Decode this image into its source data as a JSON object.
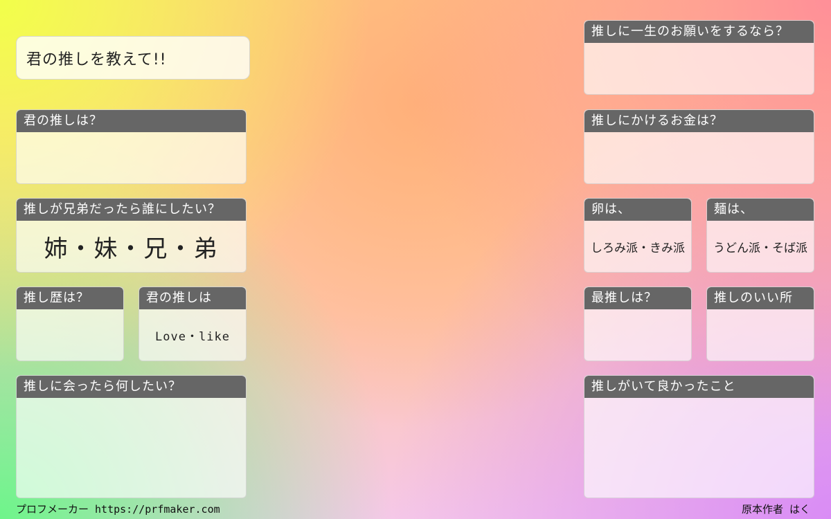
{
  "title": "君の推しを教えて!!",
  "left": {
    "q_oshi": "君の推しは？",
    "q_sibling": "推しが兄弟だったら誰にしたい？",
    "sibling_options": "姉・妹・兄・弟",
    "q_history": "推し歴は？",
    "q_love": "君の推しは",
    "love_options": "Love・like",
    "q_meet": "推しに会ったら何したい？"
  },
  "right": {
    "q_wish": "推しに一生のお願いをするなら？",
    "q_money": "推しにかけるお金は？",
    "q_egg": "卵は、",
    "egg_options": "しろみ派・きみ派",
    "q_noodle": "麺は、",
    "noodle_options": "うどん派・そば派",
    "q_favorite": "最推しは？",
    "q_good_point": "推しのいい所",
    "q_glad": "推しがいて良かったこと"
  },
  "footer": {
    "left_text": "プロフメーカー https://prfmaker.com",
    "right_text": "原本作者 はく"
  }
}
